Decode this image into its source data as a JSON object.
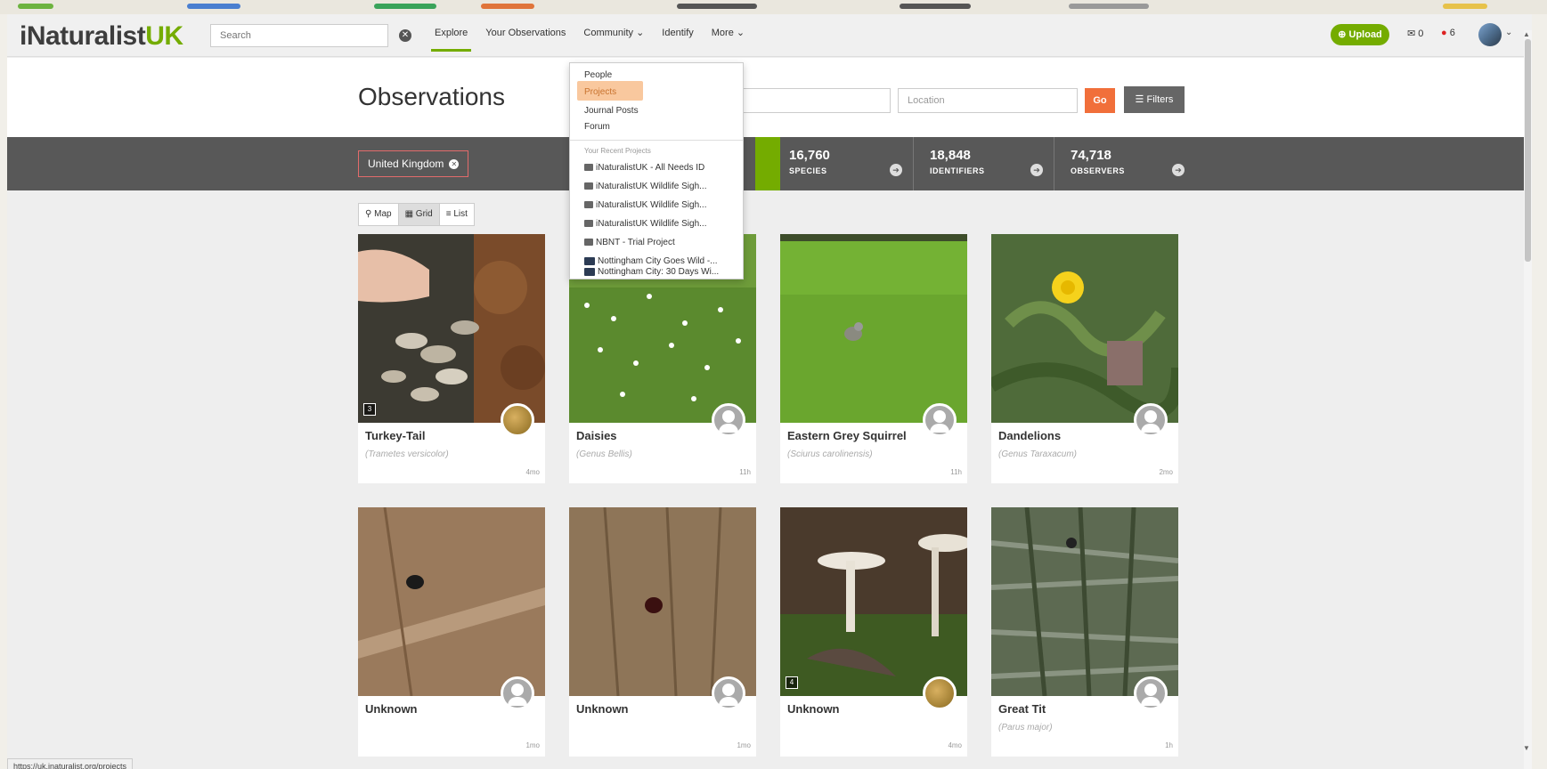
{
  "header": {
    "logo_main": "iNaturalist",
    "logo_uk": "UK",
    "search_placeholder": "Search",
    "nav": {
      "explore": "Explore",
      "your_observations": "Your Observations",
      "community": "Community ⌄",
      "identify": "Identify",
      "more": "More ⌄"
    },
    "upload_label": "Upload",
    "messages_count": "0",
    "notifications_count": "6",
    "colors": {
      "brand_green": "#74ac00",
      "accent_orange": "#f16f3a"
    }
  },
  "community_menu": {
    "people": "People",
    "projects": "Projects",
    "journal_posts": "Journal Posts",
    "forum": "Forum",
    "recent_heading": "Your Recent Projects",
    "recent": [
      "iNaturalistUK - All Needs ID",
      "iNaturalistUK Wildlife Sigh...",
      "iNaturalistUK Wildlife Sigh...",
      "iNaturalistUK Wildlife Sigh...",
      "NBNT - Trial Project",
      "Nottingham City Goes Wild -...",
      "Nottingham City: 30 Days Wi..."
    ]
  },
  "page": {
    "title": "Observations",
    "location_placeholder": "Location",
    "go_label": "Go",
    "filters_label": "Filters"
  },
  "stats": {
    "place": "United Kingdom",
    "species": {
      "value": "16,760",
      "label": "SPECIES"
    },
    "identifiers": {
      "value": "18,848",
      "label": "IDENTIFIERS"
    },
    "observers": {
      "value": "74,718",
      "label": "OBSERVERS"
    }
  },
  "view_toggle": {
    "map": "Map",
    "grid": "Grid",
    "list": "List"
  },
  "observations": [
    {
      "name": "Turkey-Tail",
      "sci": "(Trametes versicolor)",
      "age": "4mo",
      "count": "3"
    },
    {
      "name": "Daisies",
      "sci": "(Genus Bellis)",
      "age": "11h"
    },
    {
      "name": "Eastern Grey Squirrel",
      "sci": "(Sciurus carolinensis)",
      "age": "11h"
    },
    {
      "name": "Dandelions",
      "sci": "(Genus Taraxacum)",
      "age": "2mo"
    },
    {
      "name": "Unknown",
      "sci": "",
      "age": "1mo"
    },
    {
      "name": "Unknown",
      "sci": "",
      "age": "1mo"
    },
    {
      "name": "Unknown",
      "sci": "",
      "age": "4mo",
      "count": "4"
    },
    {
      "name": "Great Tit",
      "sci": "(Parus major)",
      "age": "1h"
    }
  ],
  "status_url": "https://uk.inaturalist.org/projects"
}
